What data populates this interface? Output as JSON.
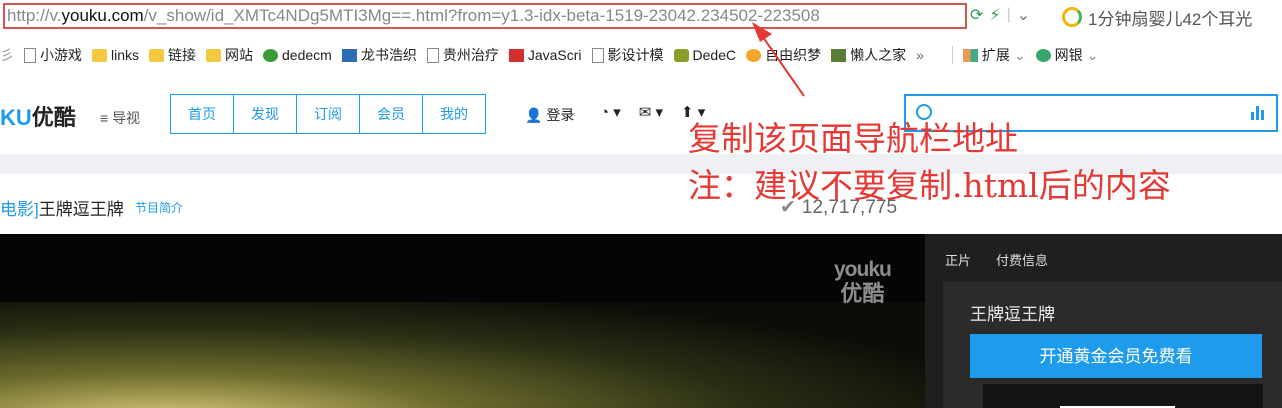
{
  "browser": {
    "url_prefix": "http://v.",
    "url_domain": "youku.com",
    "url_rest": "/v_show/id_XMTc4NDg5MTI3Mg==.html?from=y1.3-idx-beta-1519-23042.234502-223508",
    "search_hint": "1分钟扇婴儿42个耳光",
    "bookmarks": [
      {
        "label": "小游戏",
        "icon": "page-icon"
      },
      {
        "label": "links",
        "icon": "folder-icon"
      },
      {
        "label": "链接",
        "icon": "folder-icon"
      },
      {
        "label": "网站",
        "icon": "folder-icon"
      },
      {
        "label": "dedecm",
        "icon": "green-site-icon"
      },
      {
        "label": "龙书浩织",
        "icon": "blue-site-icon"
      },
      {
        "label": "贵州治疗",
        "icon": "page-icon"
      },
      {
        "label": "JavaScri",
        "icon": "red-e-icon"
      },
      {
        "label": "影设计模",
        "icon": "page-icon"
      },
      {
        "label": "DedeC",
        "icon": "olive-site-icon"
      },
      {
        "label": "自由织梦",
        "icon": "orange-site-icon"
      },
      {
        "label": "懒人之家",
        "icon": "brown-site-icon"
      }
    ],
    "more": "»",
    "ext": [
      {
        "label": "扩展",
        "icon": "grid-icon"
      },
      {
        "label": "网银",
        "icon": "bank-icon"
      }
    ]
  },
  "youku": {
    "logo_ku": "KU",
    "logo_text": "优酷",
    "guide": "导视",
    "nav": [
      "首页",
      "发现",
      "订阅",
      "会员",
      "我的"
    ],
    "login": "登录",
    "title_cat": "电影]",
    "title": "王牌逗王牌",
    "intro": "节目简介",
    "views": "12,717,775",
    "watermark_top": "youku",
    "watermark_bottom": "优酷",
    "side_tabs": [
      "正片",
      "付费信息"
    ],
    "side_program": "王牌逗王牌",
    "vip_button": "开通黄金会员免费看"
  },
  "annotation": {
    "line1": "复制该页面导航栏地址",
    "line2": "注：建议不要复制.html后的内容",
    "color": "#e53935"
  }
}
